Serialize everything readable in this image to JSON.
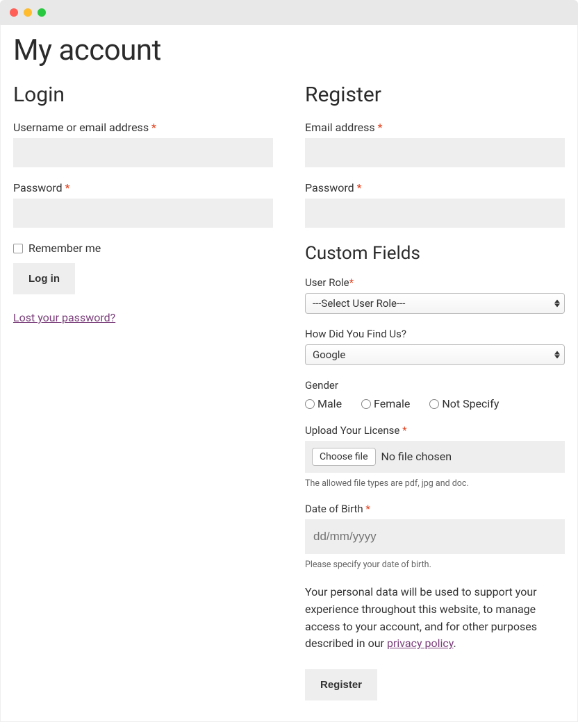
{
  "window": {
    "title": "My account"
  },
  "login": {
    "heading": "Login",
    "username_label": "Username or email address ",
    "password_label": "Password ",
    "remember_label": "Remember me",
    "submit_label": "Log in",
    "lost_password_label": "Lost your password?"
  },
  "register": {
    "heading": "Register",
    "email_label": "Email address ",
    "password_label": "Password ",
    "custom_fields_heading": "Custom Fields",
    "user_role": {
      "label": "User Role",
      "selected": "---Select User Role---"
    },
    "find_us": {
      "label": "How Did You Find Us?",
      "selected": "Google"
    },
    "gender": {
      "label": "Gender",
      "options": [
        "Male",
        "Female",
        "Not Specify"
      ]
    },
    "upload": {
      "label": "Upload Your License ",
      "button": "Choose file",
      "status": "No file chosen",
      "hint": "The allowed file types are pdf, jpg and doc."
    },
    "dob": {
      "label": "Date of Birth ",
      "placeholder": "dd/mm/yyyy",
      "hint": "Please specify your date of birth."
    },
    "privacy_text_pre": "Your personal data will be used to support your experience throughout this website, to manage access to your account, and for other purposes described in our ",
    "privacy_link": "privacy policy",
    "privacy_text_post": ".",
    "submit_label": "Register"
  },
  "required_marker": "*"
}
